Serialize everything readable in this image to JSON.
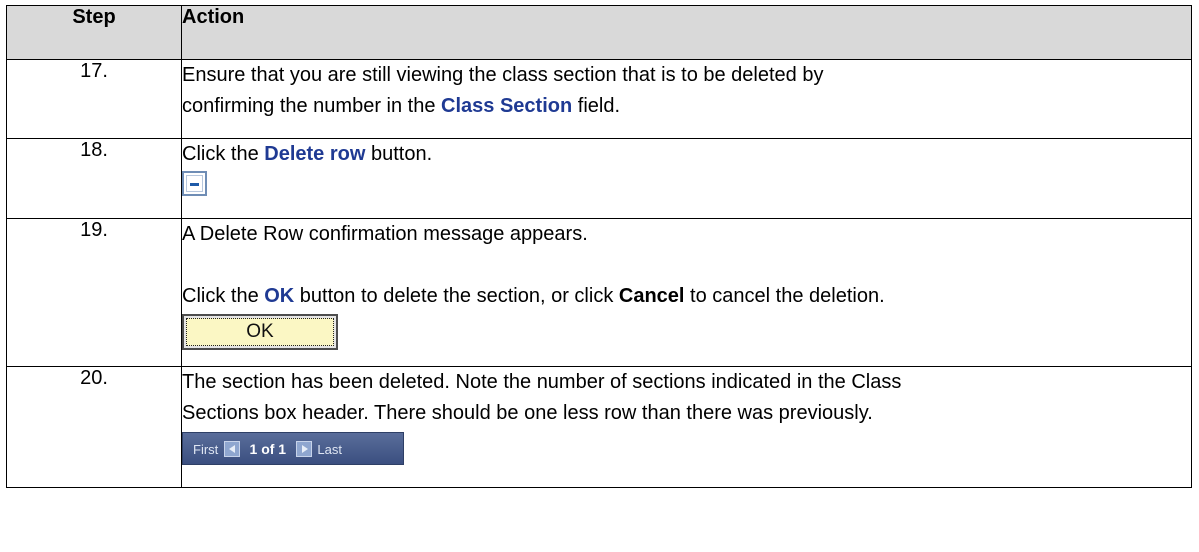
{
  "headers": {
    "step": "Step",
    "action": "Action"
  },
  "rows": [
    {
      "step": "17.",
      "p1_a": "Ensure that you are still viewing the class section that is to be deleted by",
      "p1_b": "confirming the number in the ",
      "p1_hl": "Class Section",
      "p1_c": " field."
    },
    {
      "step": "18.",
      "p1_a": "Click the ",
      "p1_hl": "Delete row",
      "p1_b": " button.",
      "icon": "delete-row-icon"
    },
    {
      "step": "19.",
      "p1": "A Delete Row confirmation message appears.",
      "p2_a": "Click the ",
      "p2_hl": "OK",
      "p2_b": " button to delete the section, or click ",
      "p2_bold": "Cancel",
      "p2_c": " to cancel the deletion.",
      "ok_label": "OK"
    },
    {
      "step": "20.",
      "p1_a": "The section has been deleted.  Note the number of sections indicated in the Class",
      "p1_b": "Sections box header. There should be one less row than there was previously.",
      "nav": {
        "first": "First",
        "count": "1 of 1",
        "last": "Last"
      }
    }
  ],
  "colors": {
    "header_bg": "#d9d9d9",
    "highlight": "#1f3a93",
    "ok_bg": "#fbf7c4",
    "nav_bg": "#3b4f80"
  }
}
